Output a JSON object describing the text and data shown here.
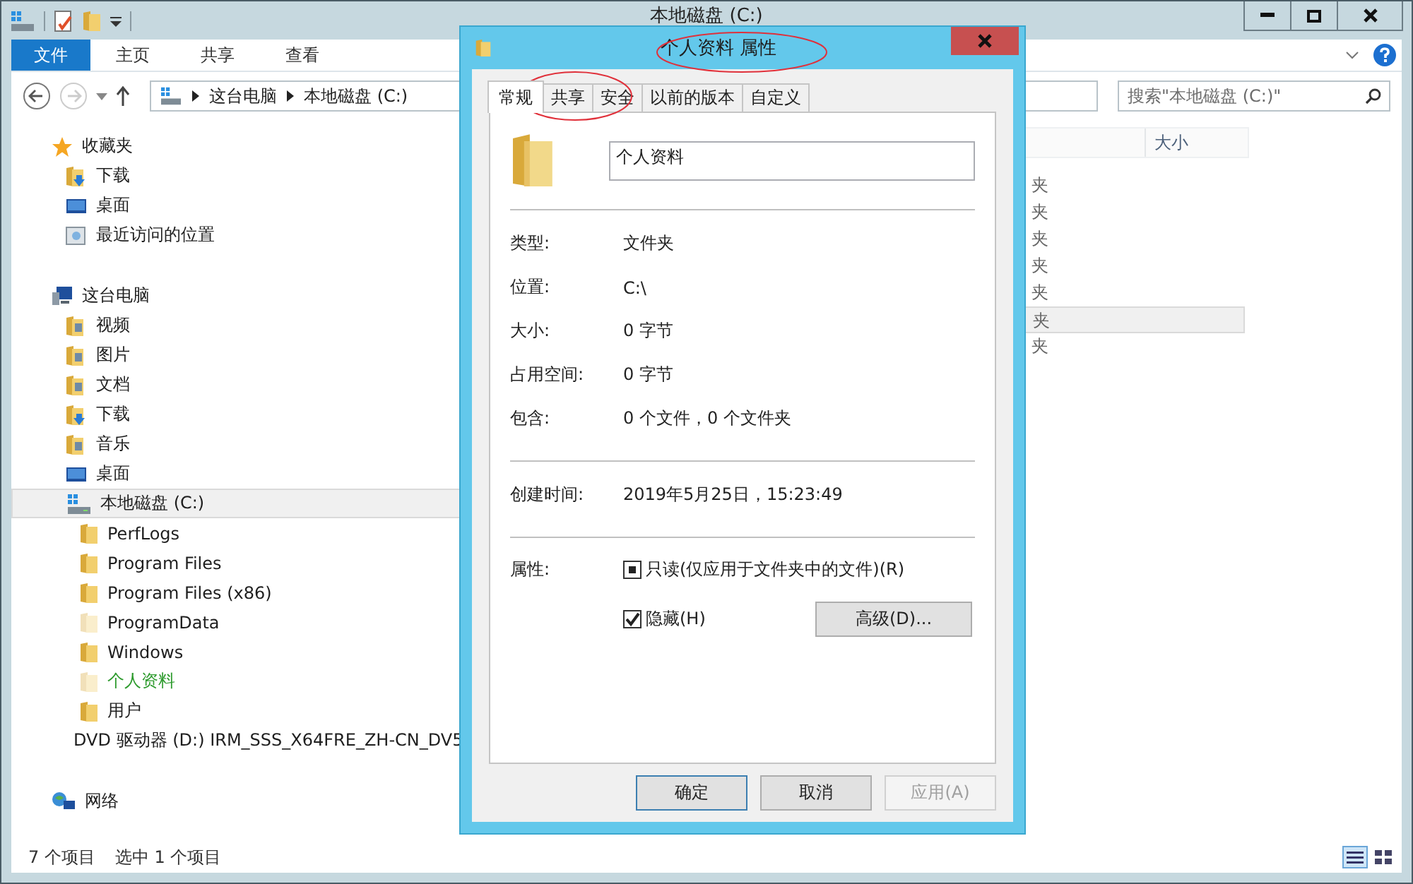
{
  "explorer": {
    "title": "本地磁盘 (C:)",
    "ribbon_tabs": [
      {
        "label": "文件",
        "selected": true
      },
      {
        "label": "主页",
        "selected": false
      },
      {
        "label": "共享",
        "selected": false
      },
      {
        "label": "查看",
        "selected": false
      }
    ],
    "address": [
      "这台电脑",
      "本地磁盘 (C:)"
    ],
    "search": {
      "placeholder": "搜索\"本地磁盘 (C:)\""
    },
    "nav": [
      {
        "label": "收藏夹",
        "kind": "star",
        "selected": false,
        "children": [
          {
            "label": "下载",
            "kind": "downloads",
            "selected": false
          },
          {
            "label": "桌面",
            "kind": "desktop",
            "selected": false
          },
          {
            "label": "最近访问的位置",
            "kind": "recent",
            "selected": false
          }
        ]
      },
      {
        "label": "这台电脑",
        "kind": "computer",
        "selected": false,
        "children": [
          {
            "label": "视频",
            "kind": "videos",
            "selected": false
          },
          {
            "label": "图片",
            "kind": "pictures",
            "selected": false
          },
          {
            "label": "文档",
            "kind": "documents",
            "selected": false
          },
          {
            "label": "下载",
            "kind": "downloads",
            "selected": false
          },
          {
            "label": "音乐",
            "kind": "music",
            "selected": false
          },
          {
            "label": "桌面",
            "kind": "desktop",
            "selected": false
          },
          {
            "label": "本地磁盘 (C:)",
            "kind": "drive",
            "selected": true,
            "children": [
              {
                "label": "PerfLogs",
                "kind": "folder",
                "selected": false
              },
              {
                "label": "Program Files",
                "kind": "folder",
                "selected": false
              },
              {
                "label": "Program Files (x86)",
                "kind": "folder",
                "selected": false
              },
              {
                "label": "ProgramData",
                "kind": "hidden-folder",
                "selected": false
              },
              {
                "label": "Windows",
                "kind": "folder",
                "selected": false
              },
              {
                "label": "个人资料",
                "kind": "hidden-folder",
                "selected": false,
                "color": "#2e9b2e"
              },
              {
                "label": "用户",
                "kind": "folder",
                "selected": false
              }
            ]
          },
          {
            "label": "DVD 驱动器 (D:) IRM_SSS_X64FRE_ZH-CN_DV5",
            "kind": "dvd",
            "selected": false
          }
        ]
      },
      {
        "label": "网络",
        "kind": "network",
        "selected": false
      }
    ],
    "columns": [
      "大小"
    ],
    "rows": [
      {
        "type": "夹",
        "selected": false
      },
      {
        "type": "夹",
        "selected": false
      },
      {
        "type": "夹",
        "selected": false
      },
      {
        "type": "夹",
        "selected": false
      },
      {
        "type": "夹",
        "selected": false
      },
      {
        "type": "夹",
        "selected": true
      },
      {
        "type": "夹",
        "selected": false
      }
    ],
    "status_bar": [
      "7 个项目",
      "选中 1 个项目"
    ]
  },
  "dialog": {
    "title": "个人资料 属性",
    "tabs": [
      {
        "label": "常规",
        "selected": true
      },
      {
        "label": "共享",
        "selected": false
      },
      {
        "label": "安全",
        "selected": false
      },
      {
        "label": "以前的版本",
        "selected": false
      },
      {
        "label": "自定义",
        "selected": false
      }
    ],
    "name": "个人资料",
    "groups": [
      [
        {
          "label": "类型:",
          "value": "文件夹"
        },
        {
          "label": "位置:",
          "value": "C:\\"
        },
        {
          "label": "大小:",
          "value": "0 字节"
        },
        {
          "label": "占用空间:",
          "value": "0 字节"
        },
        {
          "label": "包含:",
          "value": "0 个文件，0 个文件夹"
        }
      ],
      [
        {
          "label": "创建时间:",
          "value": "2019年5月25日，15:23:49"
        }
      ]
    ],
    "attributes_label": "属性:",
    "attributes": [
      {
        "label": "只读(仅应用于文件夹中的文件)(R)",
        "checked": false,
        "indeterminate": true
      },
      {
        "label": "隐藏(H)",
        "checked": true,
        "indeterminate": false
      }
    ],
    "advanced_button": "高级(D)...",
    "buttons": [
      {
        "label": "确定",
        "disabled": false,
        "default": true
      },
      {
        "label": "取消",
        "disabled": false,
        "default": false
      },
      {
        "label": "应用(A)",
        "disabled": true,
        "default": false
      }
    ]
  }
}
